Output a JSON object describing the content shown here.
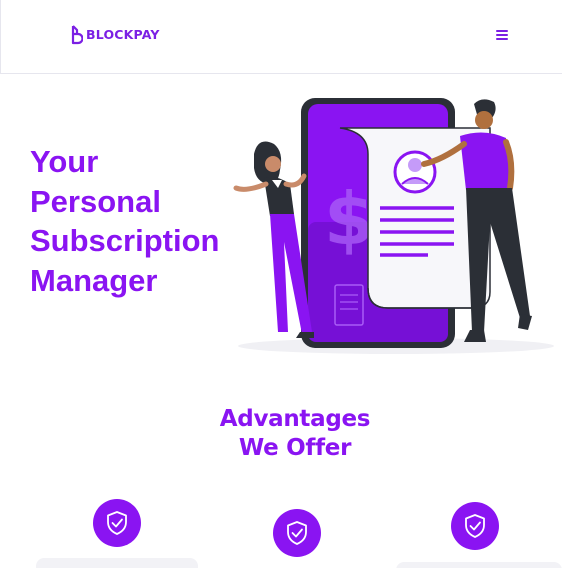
{
  "header": {
    "brand": "BLOCKPAY",
    "logo_icon": "blockpay-b-mark",
    "menu_icon": "hamburger-menu-icon"
  },
  "hero": {
    "title_lines": [
      "Your",
      "Personal",
      "Subscription",
      "Manager"
    ]
  },
  "advantages": {
    "title_lines": [
      "Advantages",
      "We Offer"
    ],
    "items": [
      {
        "icon": "shield-check-icon"
      },
      {
        "icon": "shield-check-icon"
      },
      {
        "icon": "shield-check-icon"
      }
    ]
  },
  "colors": {
    "brand_purple": "#8a14f2",
    "dark": "#2b2f36",
    "white": "#ffffff"
  }
}
